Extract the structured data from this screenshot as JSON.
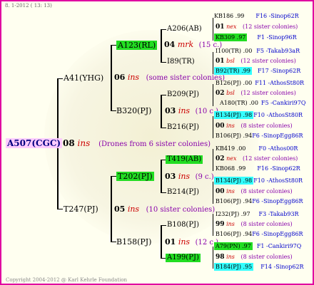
{
  "header": {
    "date": "8. 1-2012 ( 13: 13)"
  },
  "footer": {
    "copyright": "Copyright 2004-2012 @ Karl Kehrle Foundation"
  },
  "root": {
    "name": "A507(CGC)",
    "gen_num": "08",
    "gen_tag": "ins",
    "note": "(Drones from 6 sister colonies)"
  },
  "queen_a41": {
    "name": "A41(YHG)",
    "gen_num": "06",
    "gen_tag": "ins",
    "note": "(some sister colonies)"
  },
  "queen_t247": {
    "name": "T247(PJ)",
    "gen_num": "05",
    "gen_tag": "ins",
    "note": "(10 sister colonies)"
  },
  "queen_a123": {
    "name": "A123(RL)",
    "gen_num": "04",
    "gen_tag": "mrk",
    "note": "(15 c.)"
  },
  "queen_b320": {
    "name": "B320(PJ)",
    "gen_num": "03",
    "gen_tag": "ins",
    "note": "(10 c.)"
  },
  "queen_t202": {
    "name": "T202(PJ)",
    "gen_num": "03",
    "gen_tag": "ins",
    "note": "(9 c.)"
  },
  "queen_b158": {
    "name": "B158(PJ)",
    "gen_num": "01",
    "gen_tag": "ins",
    "note": "(12 c.)"
  },
  "l4": {
    "a206": "A206(AB)",
    "i89": "I89(TR)",
    "b209": "B209(PJ)",
    "b216": "B216(PJ)",
    "t419": "T419(AB)",
    "b214": "B214(PJ)",
    "b108": "B108(PJ)",
    "a199": "A199(PJ)"
  },
  "right": [
    {
      "left": "KB186 .99",
      "right": "F16 -Sinop62R"
    },
    {
      "num": "01",
      "tag": "nex",
      "note": "(12 sister colonies)"
    },
    {
      "left": "KB309 .97",
      "right": "F1 -Sinop96R"
    },
    {
      "left": "I100(TR) .00",
      "right": "F5 -Takab93aR"
    },
    {
      "num": "01",
      "tag": "bsl",
      "note": "(12 sister colonies)"
    },
    {
      "left": "B92(TR) .99",
      "right": "F17 -Sinop62R"
    },
    {
      "left": "B126(PJ) .00",
      "right": "F11 -AthosSt80R"
    },
    {
      "num": "02",
      "tag": "bsl",
      "note": "(12 sister colonies)"
    },
    {
      "left": "A180(TR) .00",
      "right": "F5 -Cankiri97Q"
    },
    {
      "left": "B134(PJ) .98",
      "right": "F10 -AthosSt80R"
    },
    {
      "num": "00",
      "tag": "ins",
      "note": "(8 sister colonies)"
    },
    {
      "left": "B106(PJ) .94",
      "right": "F6 -SinopEgg86R"
    },
    {
      "left": "KB419 .00",
      "right": "F0 -Athos00R"
    },
    {
      "num": "02",
      "tag": "nex",
      "note": "(12 sister colonies)"
    },
    {
      "left": "KB068 .99",
      "right": "F16 -Sinop62R"
    },
    {
      "left": "B134(PJ) .98",
      "right": "F10 -AthosSt80R"
    },
    {
      "num": "00",
      "tag": "ins",
      "note": "(8 sister colonies)"
    },
    {
      "left": "B106(PJ) .94",
      "right": "F6 -SinopEgg86R"
    },
    {
      "left": "I232(PJ) .97",
      "right": "F3 -Takab93R"
    },
    {
      "num": "99",
      "tag": "ins",
      "note": "(8 sister colonies)"
    },
    {
      "left": "B106(PJ) .94",
      "right": "F6 -SinopEgg86R"
    },
    {
      "left": "A79(PN) .97",
      "right": "F1 -Cankiri97Q"
    },
    {
      "num": "98",
      "tag": "ins",
      "note": "(8 sister colonies)"
    },
    {
      "left": "B184(PJ) .95",
      "right": "F14 -Sinop62R"
    }
  ]
}
